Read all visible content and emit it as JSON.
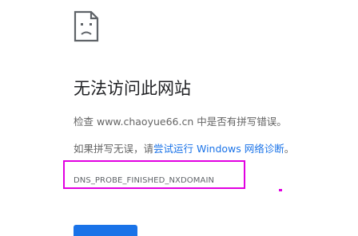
{
  "error_page": {
    "title": "无法访问此网站",
    "check_text": "检查 www.chaoyue66.cn 中是否有拼写错误。",
    "retry_prefix": "如果拼写无误，请",
    "diagnostics_link": "尝试运行 Windows 网络诊断",
    "retry_suffix": "。",
    "error_code": "DNS_PROBE_FINISHED_NXDOMAIN"
  },
  "icons": {
    "sad_page": "sad-page-icon"
  },
  "colors": {
    "link": "#1a73e8",
    "annotation": "#e100e1",
    "title": "#202124",
    "body_text": "#646464"
  }
}
